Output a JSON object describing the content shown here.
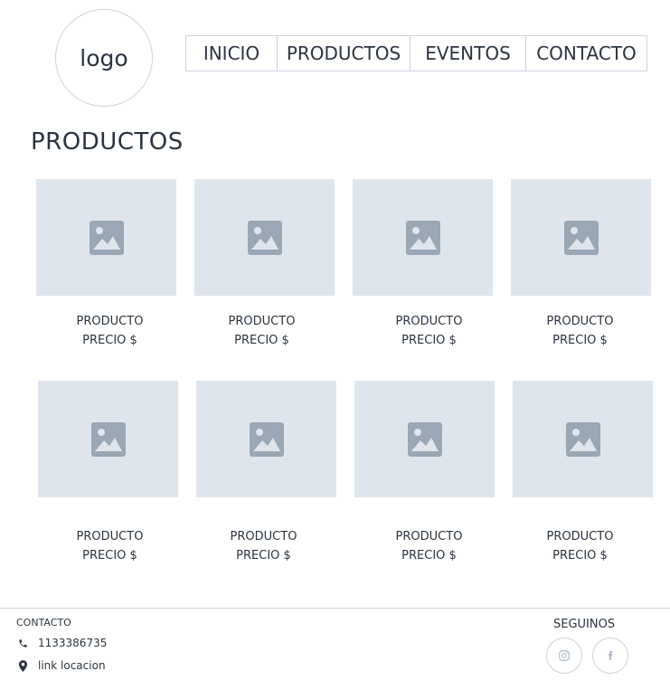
{
  "header": {
    "logo_text": "logo",
    "nav": [
      "INICIO",
      "PRODUCTOS",
      "EVENTOS",
      "CONTACTO"
    ]
  },
  "main": {
    "title": "PRODUCTOS",
    "products": [
      {
        "name": "PRODUCTO",
        "price": "PRECIO $"
      },
      {
        "name": "PRODUCTO",
        "price": "PRECIO $"
      },
      {
        "name": "PRODUCTO",
        "price": "PRECIO $"
      },
      {
        "name": "PRODUCTO",
        "price": "PRECIO $"
      },
      {
        "name": "PRODUCTO",
        "price": "PRECIO $"
      },
      {
        "name": "PRODUCTO",
        "price": "PRECIO $"
      },
      {
        "name": "PRODUCTO",
        "price": "PRECIO $"
      },
      {
        "name": "PRODUCTO",
        "price": "PRECIO $"
      }
    ]
  },
  "footer": {
    "contact_heading": "CONTACTO",
    "phone": "1133386735",
    "location": "link locacion",
    "follow_heading": "SEGUINOS",
    "social_icons": [
      "instagram-icon",
      "facebook-icon"
    ]
  },
  "colors": {
    "border": "#c9d3de",
    "placeholder_bg": "#dfe5ec",
    "placeholder_icon": "#9aa7b5",
    "text": "#2b3440"
  }
}
